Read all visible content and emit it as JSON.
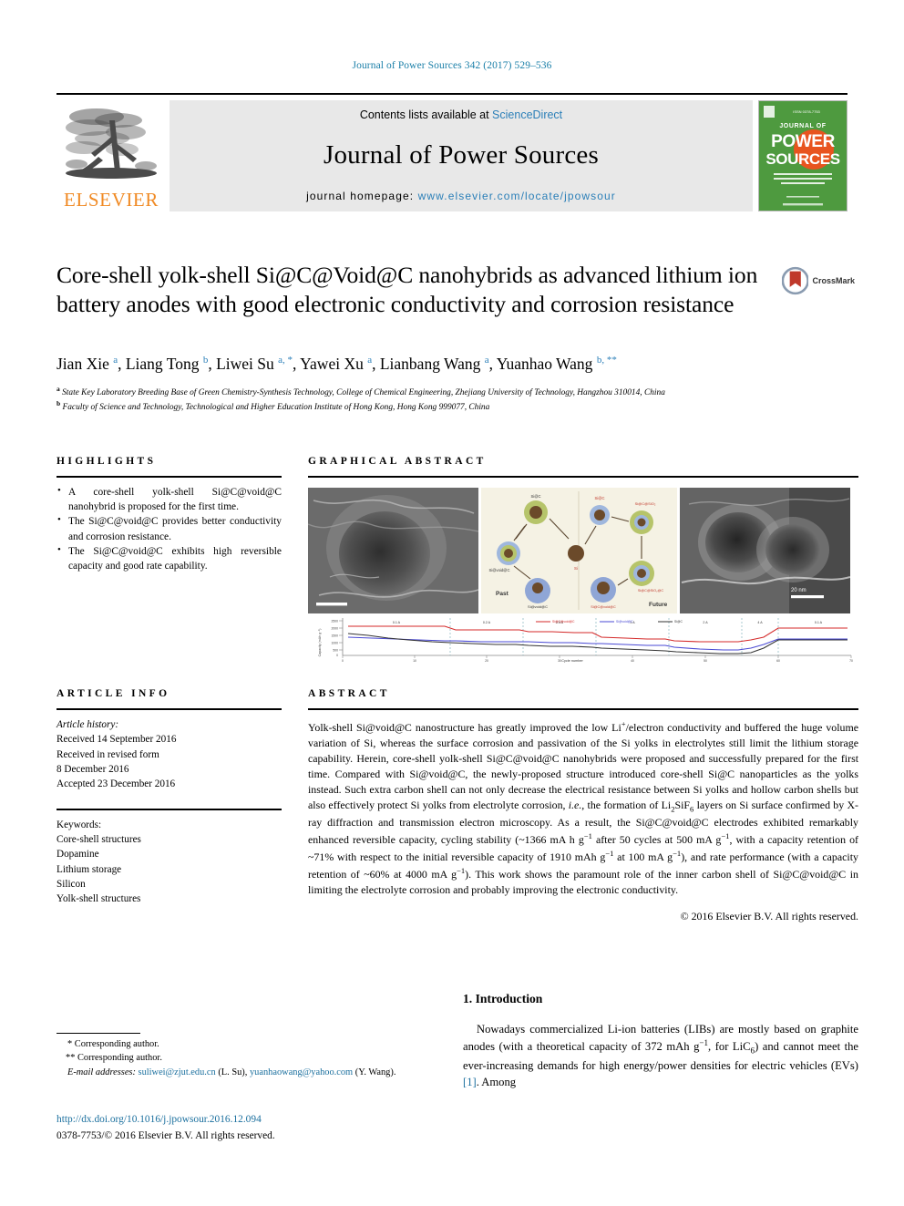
{
  "running_head": "Journal of Power Sources 342 (2017) 529–536",
  "masthead": {
    "contents_prefix": "Contents lists available at ",
    "sciencedirect": "ScienceDirect",
    "journal_name": "Journal of Power Sources",
    "homepage_prefix": "journal homepage: ",
    "homepage_url": "www.elsevier.com/locate/jpowsour",
    "publisher": "ELSEVIER",
    "cover_title_small": "JOURNAL OF",
    "cover_title_1": "POWER",
    "cover_title_2": "SOURCES",
    "accent_link_color": "#2b7fb8",
    "publisher_color": "#f08a24",
    "cover_green": "#4e9a3f"
  },
  "article": {
    "title": "Core-shell yolk-shell Si@C@Void@C nanohybrids as advanced lithium ion battery anodes with good electronic conductivity and corrosion resistance",
    "crossmark_label": "CrossMark",
    "authors_html": "Jian Xie <sup>a</sup>, Liang Tong <sup>b</sup>, Liwei Su <sup>a, *</sup>, Yawei Xu <sup>a</sup>, Lianbang Wang <sup>a</sup>, Yuanhao Wang <sup>b, **</sup>",
    "affiliations": [
      "State Key Laboratory Breeding Base of Green Chemistry-Synthesis Technology, College of Chemical Engineering, Zhejiang University of Technology, Hangzhou 310014, China",
      "Faculty of Science and Technology, Technological and Higher Education Institute of Hong Kong, Hong Kong 999077, China"
    ]
  },
  "highlights": {
    "heading": "HIGHLIGHTS",
    "items": [
      "A core-shell yolk-shell Si@C@void@C nanohybrid is proposed for the first time.",
      "The Si@C@void@C provides better conductivity and corrosion resistance.",
      "The Si@C@void@C exhibits high reversible capacity and good rate capability."
    ]
  },
  "graphical_abstract": {
    "heading": "GRAPHICAL ABSTRACT",
    "schematic_labels": {
      "past": "Past",
      "future": "Future",
      "si": "Si",
      "si_at_c": "Si@C",
      "si_at_void_at_c": "Si@void@C",
      "si_at_c_at_void_at_c": "Si@C@void@C"
    },
    "tem_scalebar": "20 nm"
  },
  "article_info": {
    "heading": "ARTICLE INFO",
    "history_label": "Article history:",
    "history_lines": [
      "Received 14 September 2016",
      "Received in revised form",
      "8 December 2016",
      "Accepted 23 December 2016"
    ],
    "keywords_label": "Keywords:",
    "keywords": [
      "Core-shell structures",
      "Dopamine",
      "Lithium storage",
      "Silicon",
      "Yolk-shell structures"
    ]
  },
  "abstract": {
    "heading": "ABSTRACT",
    "body_html": "Yolk-shell Si@void@C nanostructure has greatly improved the low Li<sup>+</sup>/electron conductivity and buffered the huge volume variation of Si, whereas the surface corrosion and passivation of the Si yolks in electrolytes still limit the lithium storage capability. Herein, core-shell yolk-shell Si@C@void@C nanohybrids were proposed and successfully prepared for the first time. Compared with Si@void@C, the newly-proposed structure introduced core-shell Si@C nanoparticles as the yolks instead. Such extra carbon shell can not only decrease the electrical resistance between Si yolks and hollow carbon shells but also effectively protect Si yolks from electrolyte corrosion, <i>i.e.</i>, the formation of Li<sub>2</sub>SiF<sub>6</sub> layers on Si surface confirmed by X-ray diffraction and transmission electron microscopy. As a result, the Si@C@void@C electrodes exhibited remarkably enhanced reversible capacity, cycling stability (~1366 mA h g<sup>−1</sup> after 50 cycles at 500 mA g<sup>−1</sup>, with a capacity retention of ~71% with respect to the initial reversible capacity of 1910 mAh g<sup>−1</sup> at 100 mA g<sup>−1</sup>), and rate performance (with a capacity retention of ~60% at 4000 mA g<sup>−1</sup>). This work shows the paramount role of the inner carbon shell of Si@C@void@C in limiting the electrolyte corrosion and probably improving the electronic conductivity.",
    "copyright": "© 2016 Elsevier B.V. All rights reserved."
  },
  "introduction": {
    "heading": "1. Introduction",
    "body_html": "Nowadays commercialized Li-ion batteries (LIBs) are mostly based on graphite anodes (with a theoretical capacity of 372 mAh g<sup>−1</sup>, for LiC<sub>6</sub>) and cannot meet the ever-increasing demands for high energy/power densities for electric vehicles (EVs) <span class=\"ref\">[1]</span>. Among"
  },
  "footnotes": {
    "corresponding_1": "* Corresponding author.",
    "corresponding_2": "** Corresponding author.",
    "email_label": "E-mail addresses:",
    "email_1": "suliwei@zjut.edu.cn",
    "email_1_who": "(L. Su),",
    "email_2": "yuanhaowang@yahoo.com",
    "email_2_who": "(Y. Wang).",
    "doi": "http://dx.doi.org/10.1016/j.jpowsour.2016.12.094",
    "issn": "0378-7753/© 2016 Elsevier B.V. All rights reserved."
  },
  "chart_data": {
    "type": "line",
    "title": "",
    "xlabel": "Cycle number",
    "ylabel": "Capacity (mAh g⁻¹)",
    "x": [
      1,
      10,
      20,
      30,
      40,
      50,
      60,
      70,
      80
    ],
    "xlim": [
      0,
      80
    ],
    "ylim": [
      0,
      2500
    ],
    "rate_annotations": [
      "0.1 A",
      "0.2 A",
      "0.5 A",
      "1 A",
      "2 A",
      "4 A",
      "0.1 A"
    ],
    "legend": [
      "Si@C@void@C",
      "Si@void@C",
      "Si@C"
    ],
    "series": [
      {
        "name": "Si@C@void@C",
        "color": "#d42a2a",
        "values": [
          2050,
          2040,
          1860,
          1850,
          1560,
          1520,
          1330,
          1280,
          1810
        ]
      },
      {
        "name": "Si@void@C",
        "color": "#4a4ad4",
        "values": [
          1400,
          1280,
          1200,
          1170,
          1050,
          720,
          560,
          900,
          1310
        ]
      },
      {
        "name": "Si@C",
        "color": "#333333",
        "values": [
          1700,
          1400,
          1120,
          900,
          700,
          420,
          250,
          200,
          1300
        ]
      }
    ]
  }
}
